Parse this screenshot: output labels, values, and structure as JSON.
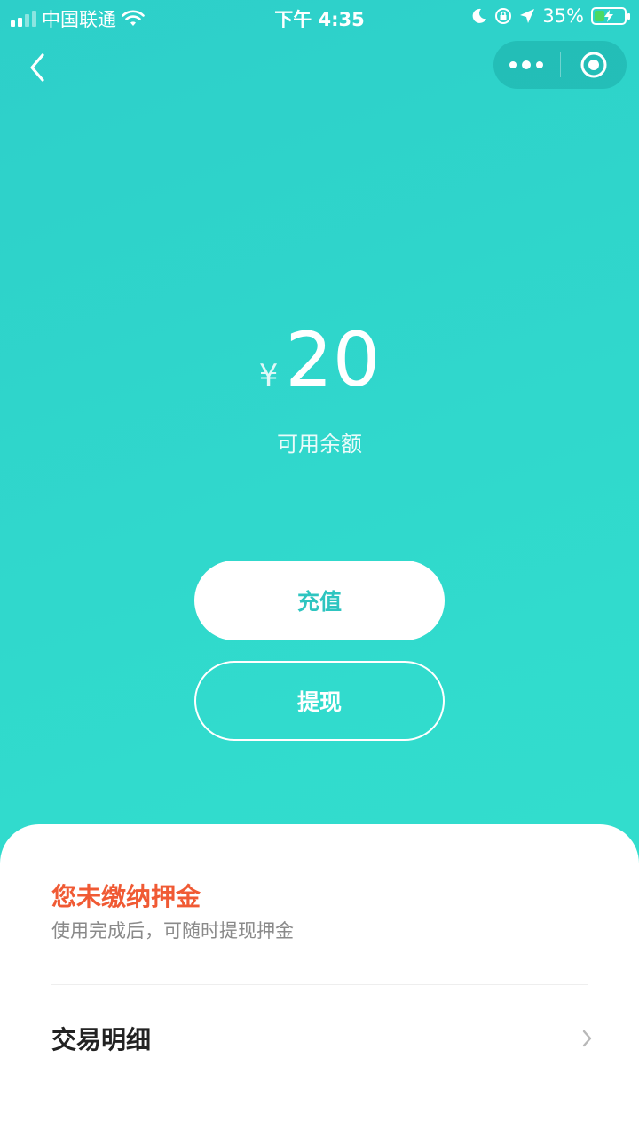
{
  "status_bar": {
    "carrier": "中国联通",
    "time": "下午 4:35",
    "battery_percent": "35%",
    "battery_level": 0.35,
    "icons": [
      "signal-icon",
      "wifi-icon",
      "moon-icon",
      "orientation-lock-icon",
      "location-arrow-icon",
      "battery-charging-icon"
    ]
  },
  "nav": {
    "back_icon": "chevron-left-icon",
    "menu_icon": "more-dots-icon",
    "close_icon": "target-circle-icon"
  },
  "balance": {
    "currency_symbol": "¥",
    "amount": "20",
    "label": "可用余额"
  },
  "actions": {
    "recharge_label": "充值",
    "withdraw_label": "提现"
  },
  "deposit": {
    "title": "您未缴纳押金",
    "subtitle": "使用完成后，可随时提现押金"
  },
  "transactions": {
    "label": "交易明细",
    "chevron_icon": "chevron-right-icon"
  },
  "colors": {
    "background": "#2fd7cc",
    "accent_text": "#2ec5c0",
    "warning": "#f05a34",
    "white": "#ffffff"
  }
}
